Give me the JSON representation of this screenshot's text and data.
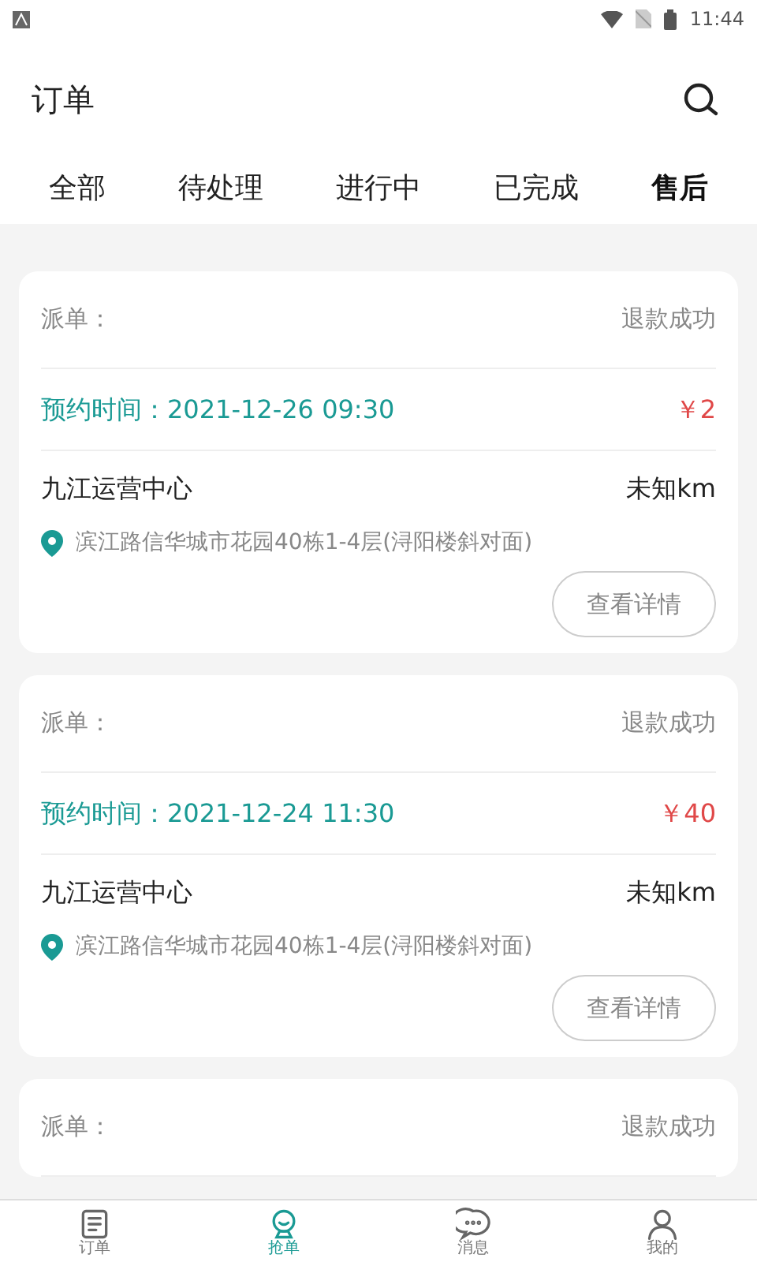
{
  "status_bar": {
    "time": "11:44"
  },
  "header": {
    "title": "订单"
  },
  "tabs": [
    {
      "label": "全部",
      "selected": false
    },
    {
      "label": "待处理",
      "selected": false
    },
    {
      "label": "进行中",
      "selected": false
    },
    {
      "label": "已完成",
      "selected": false
    },
    {
      "label": "售后",
      "selected": true
    }
  ],
  "orders": [
    {
      "dispatch_label": "派单：",
      "status": "退款成功",
      "time": "预约时间：2021-12-26 09:30",
      "price": "￥2",
      "center": "九江运营中心",
      "distance": "未知km",
      "address": "滨江路信华城市花园40栋1-4层(浔阳楼斜对面)",
      "button": "查看详情"
    },
    {
      "dispatch_label": "派单：",
      "status": "退款成功",
      "time": "预约时间：2021-12-24 11:30",
      "price": "￥40",
      "center": "九江运营中心",
      "distance": "未知km",
      "address": "滨江路信华城市花园40栋1-4层(浔阳楼斜对面)",
      "button": "查看详情"
    },
    {
      "dispatch_label": "派单：",
      "status": "退款成功"
    }
  ],
  "bottom_nav": [
    {
      "label": "订单",
      "kind": "document",
      "selected": false
    },
    {
      "label": "抢单",
      "kind": "robot",
      "selected": true
    },
    {
      "label": "消息",
      "kind": "chat",
      "selected": false
    },
    {
      "label": "我的",
      "kind": "user",
      "selected": false
    }
  ]
}
